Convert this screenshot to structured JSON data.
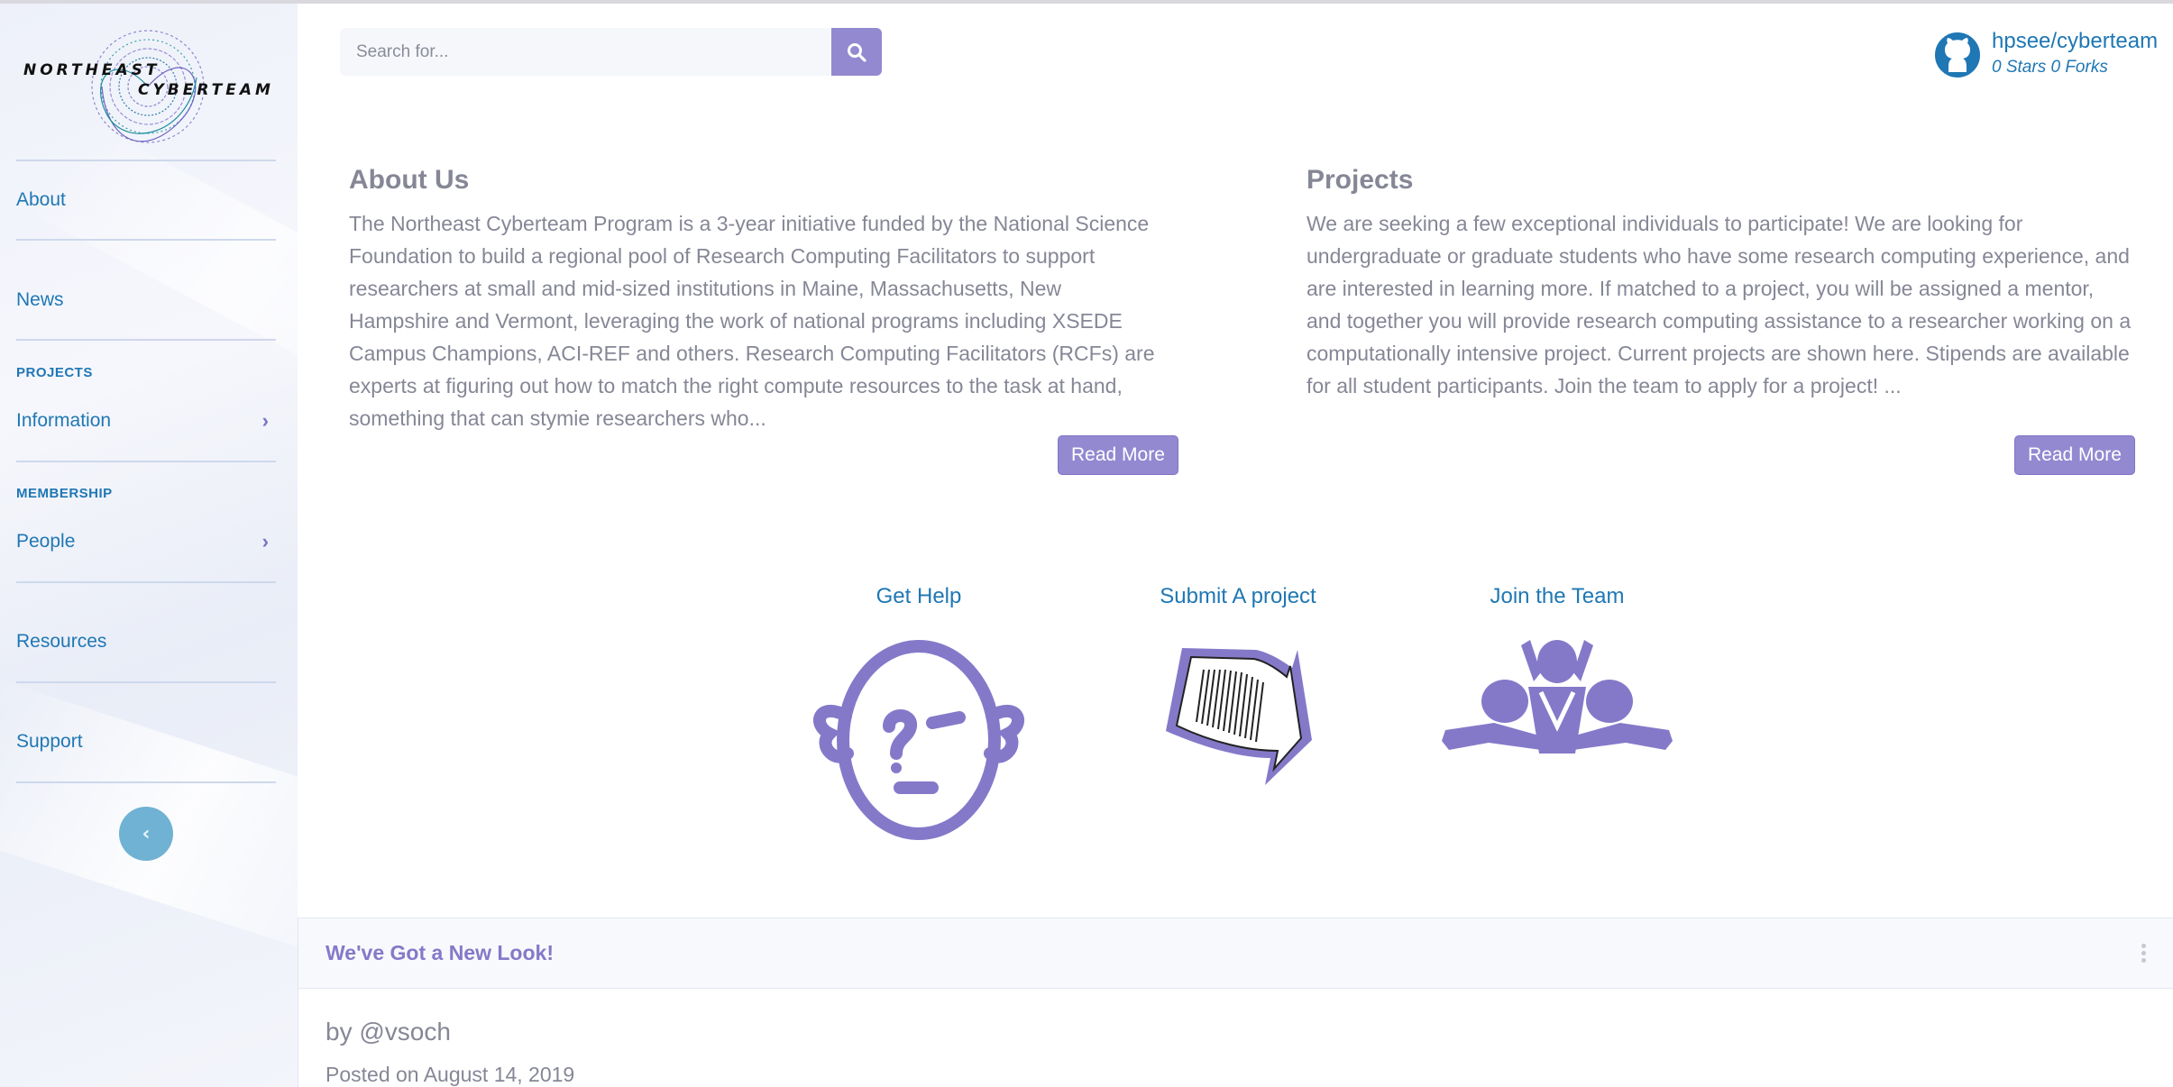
{
  "brand": {
    "line1": "NORTHEAST",
    "line2": "CYBERTEAM"
  },
  "sidebar": {
    "items": [
      {
        "label": "About"
      },
      {
        "label": "News"
      },
      {
        "heading": "PROJECTS",
        "label": "Information"
      },
      {
        "heading": "MEMBERSHIP",
        "label": "People"
      },
      {
        "label": "Resources"
      },
      {
        "label": "Support"
      }
    ],
    "toggle_glyph": "‹"
  },
  "search": {
    "placeholder": "Search for..."
  },
  "github": {
    "repo": "hpsee/cyberteam",
    "stats": "0 Stars  0 Forks"
  },
  "about": {
    "title": "About Us",
    "body": "The Northeast Cyberteam Program is a 3-year initiative funded by the National Science Foundation to build a regional pool of Research Computing Facilitators to support researchers at small and mid-sized institutions in Maine, Massachusetts, New Hampshire and Vermont, leveraging the work of national programs including XSEDE Campus Champions, ACI-REF and others. Research Computing Facilitators (RCFs) are experts at figuring out how to match the right compute resources to the task at hand, something that can stymie researchers who...",
    "read_more": "Read More"
  },
  "projects": {
    "title": "Projects",
    "body": "We are seeking a few exceptional individuals to participate! We are looking for undergraduate or graduate students who have some research computing experience, and are interested in learning more. If matched to a project, you will be assigned a mentor, and together you will provide research computing assistance to a researcher working on a computationally intensive project. Current projects are shown here. Stipends are available for all student participants. Join the team to apply for a project! ...",
    "read_more": "Read More"
  },
  "actions": [
    {
      "label": "Get Help",
      "icon": "confused-face-icon"
    },
    {
      "label": "Submit A project",
      "icon": "document-arrow-icon"
    },
    {
      "label": "Join the Team",
      "icon": "team-people-icon"
    }
  ],
  "news": {
    "title": "We've Got a New Look!",
    "byline": "by @vsoch",
    "posted": "Posted on August 14, 2019"
  },
  "colors": {
    "accent": "#9389d1",
    "link": "#1f77b4",
    "text": "#858796"
  }
}
